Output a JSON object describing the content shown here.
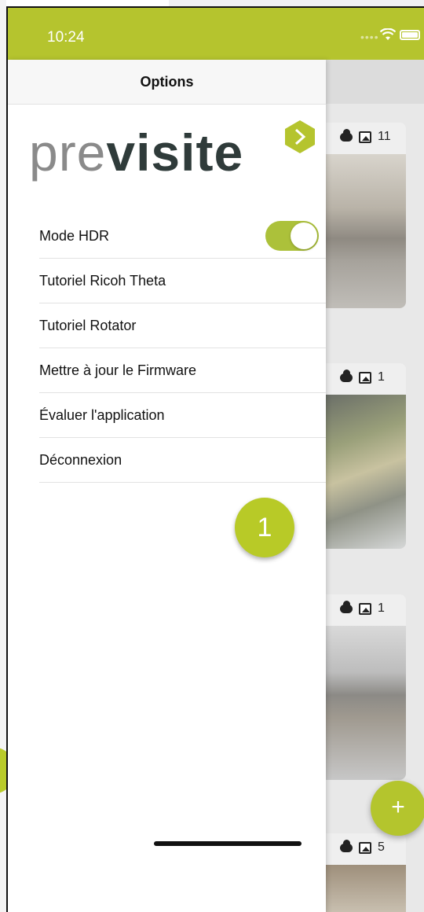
{
  "status_bar": {
    "time": "10:24",
    "accent_color": "#b5c42e"
  },
  "drawer": {
    "title": "Options",
    "logo": {
      "light": "pre",
      "bold": "visite"
    },
    "menu_items": [
      {
        "label": "Mode HDR"
      },
      {
        "label": "Tutoriel Ricoh Theta"
      },
      {
        "label": "Tutoriel Rotator"
      },
      {
        "label": "Mettre à jour le Firmware"
      },
      {
        "label": "Évaluer l'application"
      },
      {
        "label": "Déconnexion"
      }
    ],
    "hdr_toggle_on": true,
    "badge_number": "1"
  },
  "background_cards": [
    {
      "photo_count": "11"
    },
    {
      "photo_count": "1"
    },
    {
      "photo_count": "1"
    },
    {
      "photo_count": "5"
    }
  ],
  "fab_label": "+"
}
